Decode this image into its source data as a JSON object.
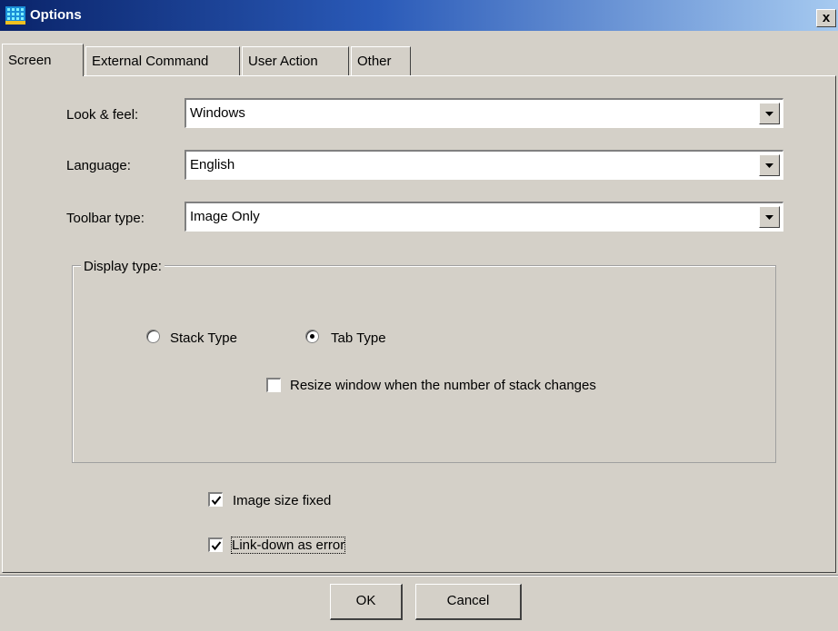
{
  "window": {
    "title": "Options",
    "close_label": "x"
  },
  "tabs": [
    {
      "label": "Screen",
      "active": true
    },
    {
      "label": "External Command",
      "active": false
    },
    {
      "label": "User Action",
      "active": false
    },
    {
      "label": "Other",
      "active": false
    }
  ],
  "form": {
    "look_feel": {
      "label": "Look & feel:",
      "value": "Windows"
    },
    "language": {
      "label": "Language:",
      "value": "English"
    },
    "toolbar_type": {
      "label": "Toolbar type:",
      "value": "Image Only"
    }
  },
  "display_type": {
    "legend": "Display type:",
    "stack_type": {
      "label": "Stack Type",
      "selected": false
    },
    "tab_type": {
      "label": "Tab Type",
      "selected": true
    },
    "resize_window": {
      "label": "Resize window when the number of stack changes",
      "checked": false
    }
  },
  "options": {
    "image_size_fixed": {
      "label": "Image size fixed",
      "checked": true
    },
    "link_down_error": {
      "label": "Link-down as error",
      "checked": true
    }
  },
  "buttons": {
    "ok": "OK",
    "cancel": "Cancel"
  },
  "colors": {
    "title_bar_start": "#0a246a",
    "title_bar_end": "#a6caf0",
    "face": "#d4d0c8"
  }
}
